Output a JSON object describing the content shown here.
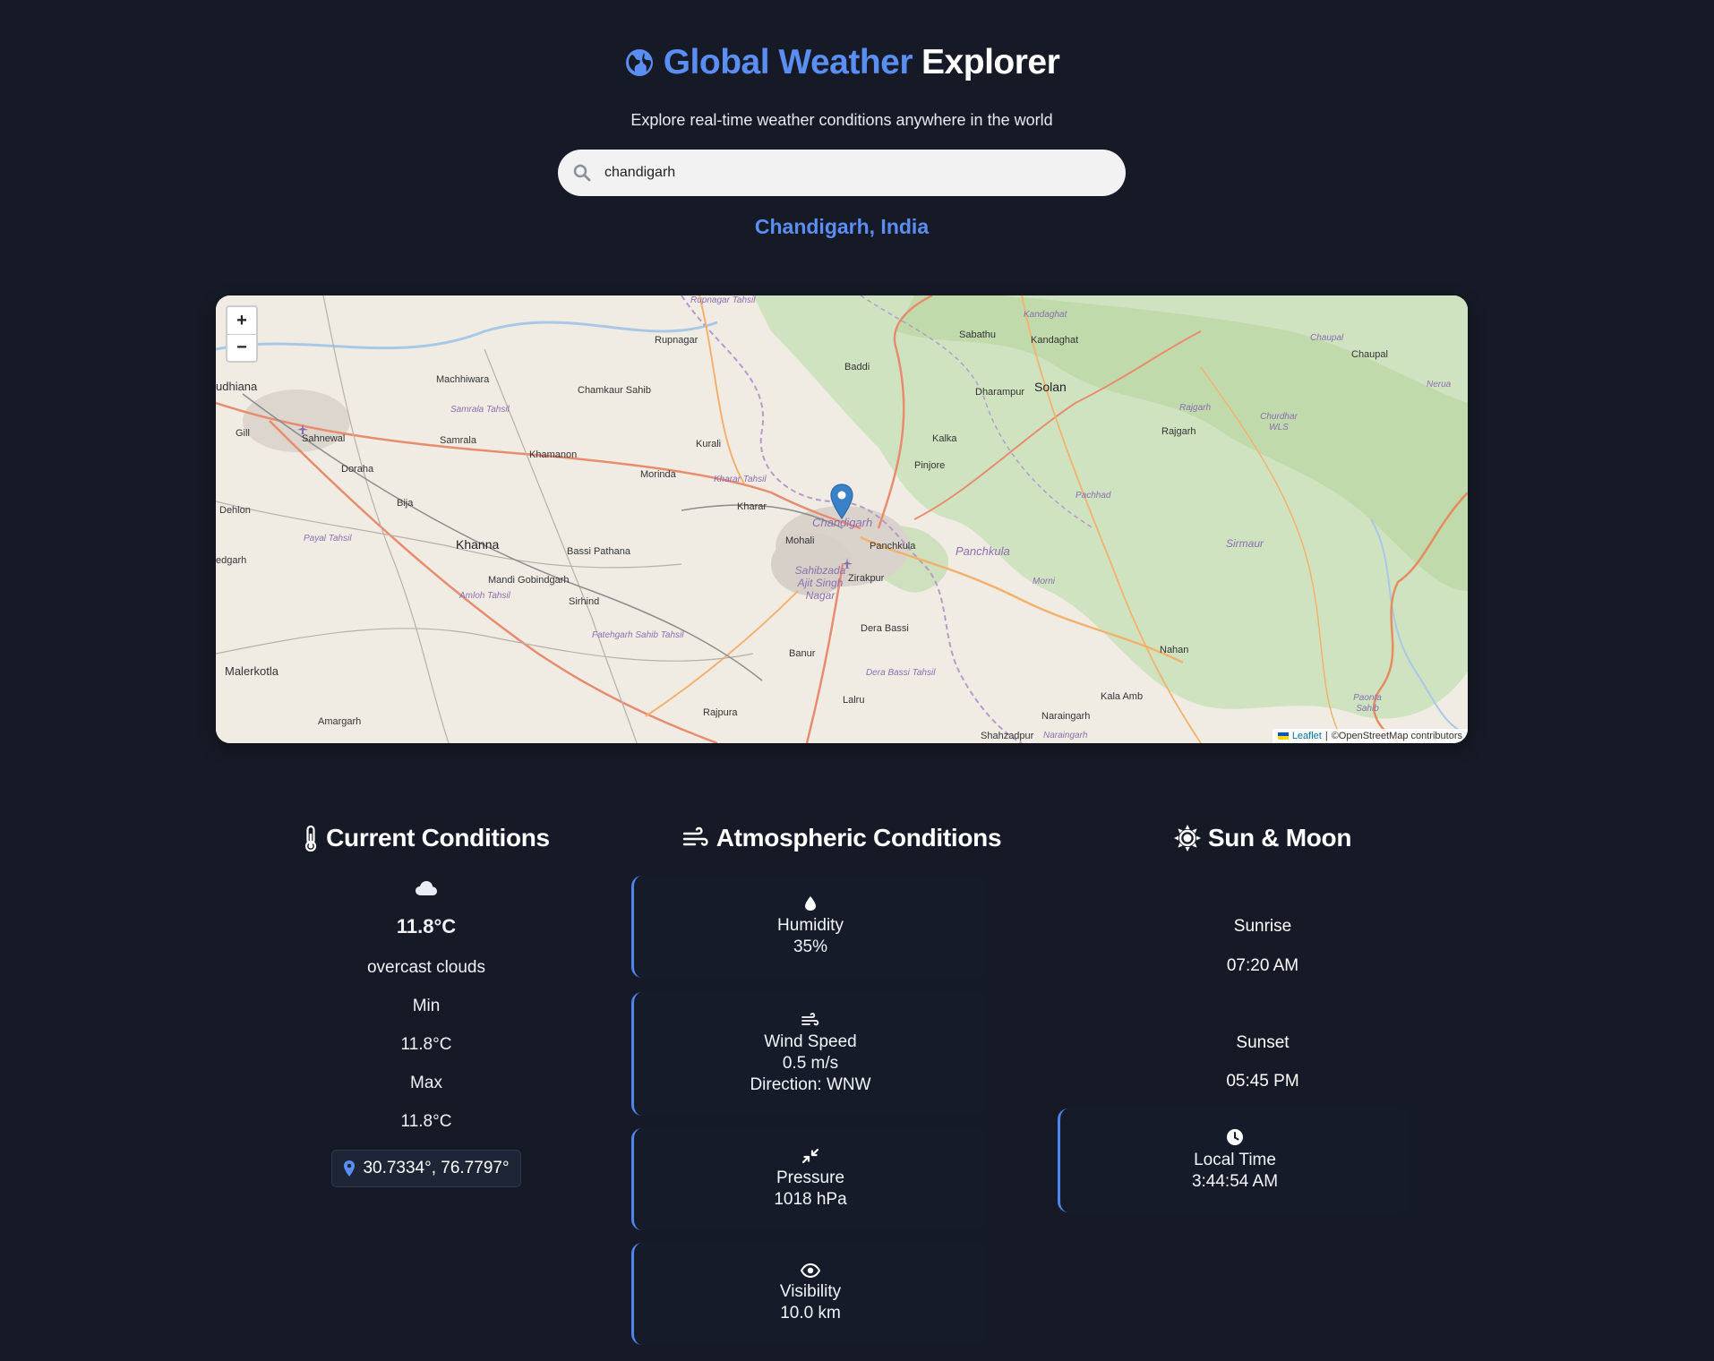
{
  "header": {
    "title_accent": "Global Weather",
    "title_rest": "Explorer",
    "subtitle": "Explore real-time weather conditions anywhere in the world"
  },
  "search": {
    "value": "chandigarh",
    "icon": "search-icon"
  },
  "location": "Chandigarh, India",
  "map": {
    "zoom_in": "+",
    "zoom_out": "−",
    "attribution": {
      "leaflet": "Leaflet",
      "separator": "|",
      "osm": "©OpenStreetMap contributors"
    },
    "places": [
      "udhiana",
      "Machhiwara",
      "Samrala Tahsil",
      "Samrala",
      "Chamkaur Sahib",
      "Rupnagar",
      "Rupnagar Tahsil",
      "Gill",
      "Sahnewal",
      "Doraha",
      "Khamanon",
      "Kurali",
      "Morinda",
      "Kharar Tahsil",
      "Kharar",
      "Dehlon",
      "Bija",
      "Payal Tahsil",
      "Khanna",
      "Bassi Pathana",
      "Mandi Gobindgarh",
      "Amloh Tahsil",
      "Sirhind",
      "Fatehgarh Sahib Tahsil",
      "edgarh",
      "Malerkotla",
      "Amargarh",
      "Rajpura",
      "Banur",
      "Lalru",
      "Dera Bassi",
      "Dera Bassi Tahsil",
      "Zirakpur",
      "Sahibzada Ajit Singh Nagar",
      "Mohali",
      "Chandigarh",
      "Panchkula",
      "Panchkula",
      "Pinjore",
      "Kalka",
      "Baddi",
      "Sabathu",
      "Kandaghat",
      "Kandaghat",
      "Dharampur",
      "Solan",
      "Chaupal",
      "Chaupal",
      "Nerua",
      "Rajgarh",
      "Rajgarh",
      "Churdhar WLS",
      "Pachhad",
      "Sirmaur",
      "Morni",
      "Nahan",
      "Kala Amb",
      "Naraingarh",
      "Naraingarh",
      "Shahzadpur",
      "Paonta Sahib"
    ]
  },
  "current": {
    "title": "Current Conditions",
    "temp": "11.8°C",
    "description": "overcast clouds",
    "min_label": "Min",
    "min_value": "11.8°C",
    "max_label": "Max",
    "max_value": "11.8°C",
    "coords": "30.7334°, 76.7797°"
  },
  "atmospheric": {
    "title": "Atmospheric Conditions",
    "humidity_label": "Humidity",
    "humidity_value": "35%",
    "wind_label": "Wind Speed",
    "wind_value": "0.5 m/s",
    "wind_direction": "Direction: WNW",
    "pressure_label": "Pressure",
    "pressure_value": "1018 hPa",
    "visibility_label": "Visibility",
    "visibility_value": "10.0 km"
  },
  "sunmoon": {
    "title": "Sun & Moon",
    "sunrise_label": "Sunrise",
    "sunrise_value": "07:20 AM",
    "sunset_label": "Sunset",
    "sunset_value": "05:45 PM",
    "localtime_label": "Local Time",
    "localtime_value": "3:44:54 AM"
  },
  "colors": {
    "accent": "#5b8ef3",
    "background": "#151a26",
    "card": "#151b29"
  }
}
